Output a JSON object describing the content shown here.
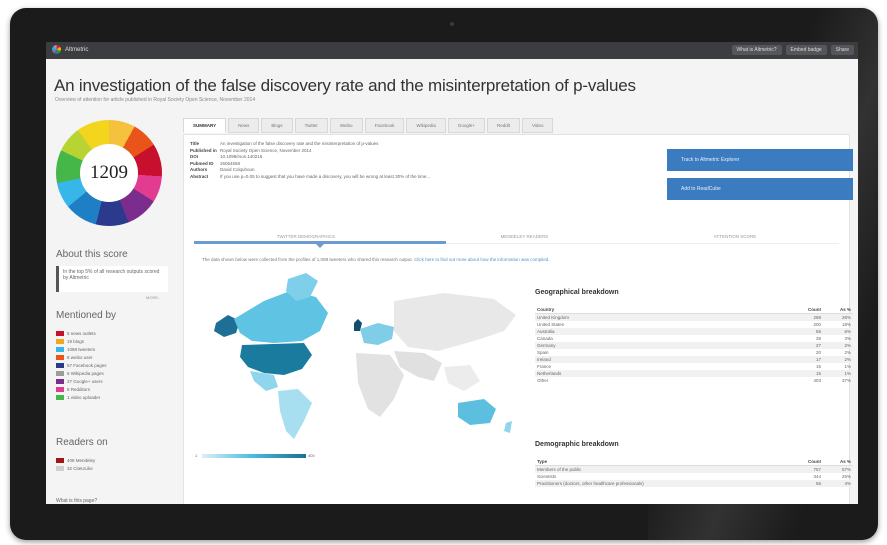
{
  "app": {
    "brand": "Altmetric"
  },
  "topbar": {
    "buttons": [
      "What is Altmetric?",
      "Embed badge",
      "Share"
    ]
  },
  "header": {
    "title": "An investigation of the false discovery rate and the misinterpretation of p-values",
    "subtitle": "Overview of attention for article published in Royal Society Open Science, November 2014"
  },
  "score": {
    "value": "1209"
  },
  "about": {
    "heading": "About this score",
    "text": "In the top 5% of all research outputs scored by Altmetric",
    "more": "MORE..."
  },
  "mentioned": {
    "heading": "Mentioned by",
    "items": [
      {
        "label": "5 news outlets",
        "color": "#c8102e"
      },
      {
        "label": "19 blogs",
        "color": "#f4a71d"
      },
      {
        "label": "1088 tweeters",
        "color": "#36b6e9"
      },
      {
        "label": "8 weibo user",
        "color": "#e8541a"
      },
      {
        "label": "57 Facebook pages",
        "color": "#2b3a8c"
      },
      {
        "label": "6 Wikipedia pages",
        "color": "#9c9c9c"
      },
      {
        "label": "27 Google+ users",
        "color": "#7b2d8e"
      },
      {
        "label": "8 Redditors",
        "color": "#e23c91"
      },
      {
        "label": "1 video uploader",
        "color": "#45b648"
      }
    ]
  },
  "readers": {
    "heading": "Readers on",
    "items": [
      {
        "label": "408 Mendeley",
        "color": "#a01616"
      },
      {
        "label": "32 CiteULike",
        "color": "#cfcfcf"
      }
    ]
  },
  "whatbox": {
    "text": "What is this page?"
  },
  "tabs": [
    "SUMMARY",
    "News",
    "Blogs",
    "Twitter",
    "Weibo",
    "Facebook",
    "Wikipedia",
    "Google+",
    "Reddit",
    "Video"
  ],
  "meta": [
    {
      "k": "Title",
      "v": "An investigation of the false discovery rate and the misinterpretation of p-values"
    },
    {
      "k": "Published in",
      "v": "Royal Society Open Science, November 2014"
    },
    {
      "k": "DOI",
      "v": "10.1098/rsos.140216"
    },
    {
      "k": "Pubmed ID",
      "v": "26064558"
    },
    {
      "k": "Authors",
      "v": "David Colquhoun"
    },
    {
      "k": "Abstract",
      "v": "If you use p=0.05 to suggest that you have made a discovery, you will be wrong at least 30% of the time..."
    }
  ],
  "actions": {
    "btn1": "Track to Altmetric Explorer",
    "btn2": "Add to ReadCube"
  },
  "subtabs": [
    "TWITTER DEMOGRAPHICS",
    "MENDELEY READERS",
    "ATTENTION SCORE"
  ],
  "intro": {
    "text": "The data shown below were collected from the profiles of 1,088 tweeters who shared this research output.",
    "link": "Click here to find out more about how the information was compiled."
  },
  "colorscale": {
    "min": "1",
    "max": "400"
  },
  "geo": {
    "title": "Geographical breakdown",
    "headers": [
      "Country",
      "Count",
      "As %"
    ],
    "rows": [
      [
        "United Kingdom",
        "288",
        "26%"
      ],
      [
        "United States",
        "200",
        "18%"
      ],
      [
        "Australia",
        "65",
        "6%"
      ],
      [
        "Canada",
        "38",
        "3%"
      ],
      [
        "Germany",
        "27",
        "2%"
      ],
      [
        "Spain",
        "20",
        "2%"
      ],
      [
        "Ireland",
        "17",
        "2%"
      ],
      [
        "France",
        "15",
        "1%"
      ],
      [
        "Netherlands",
        "15",
        "1%"
      ],
      [
        "Other",
        "403",
        "37%"
      ]
    ]
  },
  "demo": {
    "title": "Demographic breakdown",
    "headers": [
      "Type",
      "Count",
      "As %"
    ],
    "rows": [
      [
        "Members of the public",
        "757",
        "57%"
      ],
      [
        "Scientists",
        "344",
        "26%"
      ],
      [
        "Practitioners (doctors, other healthcare professionals)",
        "56",
        "4%"
      ]
    ]
  }
}
